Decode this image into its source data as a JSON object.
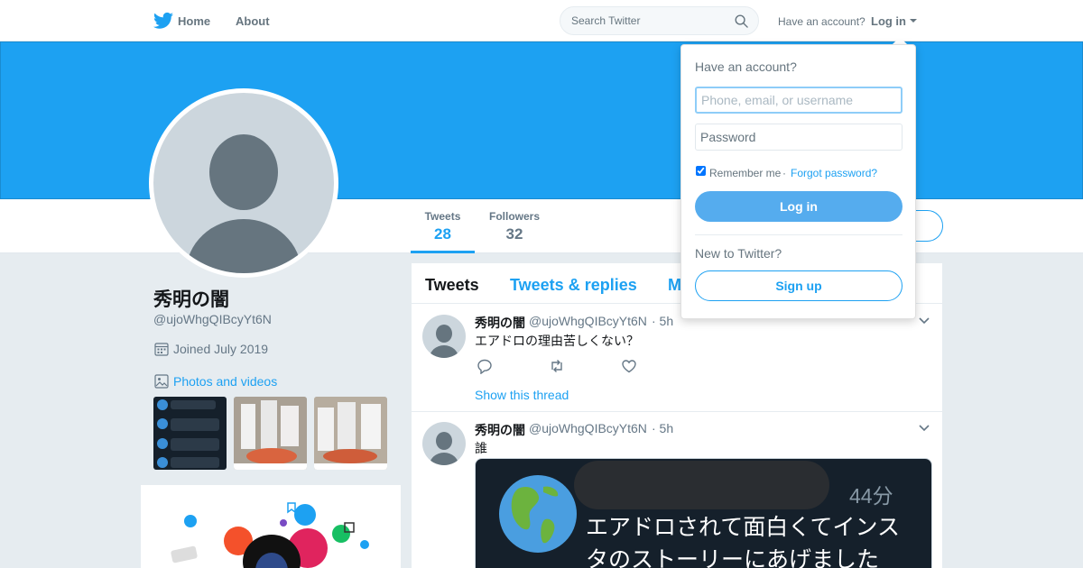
{
  "nav": {
    "home_label": "Home",
    "about_label": "About",
    "search_placeholder": "Search Twitter",
    "have_account": "Have an account?",
    "login_label": "Log in",
    "logo_icon": "twitter-bird-icon",
    "brand_color": "#1da1f2"
  },
  "profile": {
    "name": "秀明の闇",
    "handle": "@ujoWhgQIBcyYt6N",
    "joined": "Joined July 2019",
    "photos_label": "Photos and videos",
    "stats": [
      {
        "label": "Tweets",
        "value": "28"
      },
      {
        "label": "Followers",
        "value": "32"
      }
    ]
  },
  "timeline": {
    "tabs": [
      "Tweets",
      "Tweets & replies",
      "M"
    ],
    "tweets": [
      {
        "name": "秀明の闇",
        "handle": "@ujoWhgQIBcyYt6N",
        "time": "· 5h",
        "text": "エアドロの理由苦しくない？",
        "show_thread": "Show this thread"
      },
      {
        "name": "秀明の闇",
        "handle": "@ujoWhgQIBcyYt6N",
        "time": "· 5h",
        "text": "誰",
        "media": {
          "time": "44分",
          "line1": "エアドロされて面白くてインス",
          "line2": "タのストーリーにあげました"
        }
      }
    ]
  },
  "login_dropdown": {
    "title": "Have an account?",
    "user_placeholder": "Phone, email, or username",
    "password_placeholder": "Password",
    "remember_me": "Remember me",
    "separator": "·",
    "forgot": "Forgot password?",
    "login_button": "Log in",
    "new_to": "New to Twitter?",
    "signup_button": "Sign up"
  }
}
